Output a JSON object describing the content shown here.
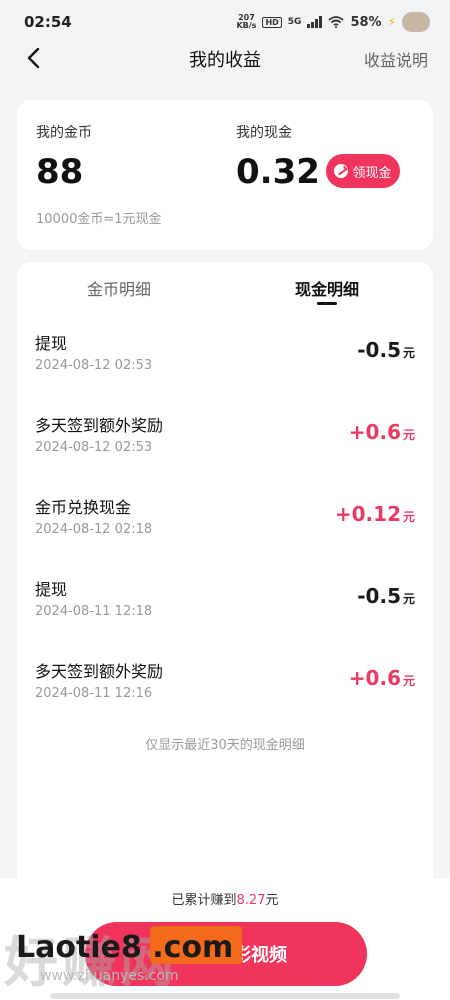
{
  "status_bar": {
    "time": "02:54",
    "speed_top": "207",
    "speed_bottom": "KB/s",
    "hd": "HD",
    "network": "5G",
    "battery": "58%"
  },
  "nav": {
    "title": "我的收益",
    "explain": "收益说明"
  },
  "summary": {
    "coin_label": "我的金币",
    "coin_value": "88",
    "cash_label": "我的现金",
    "cash_value": "0.32",
    "claim_label": "领现金",
    "rate_text": "10000金币=1元现金"
  },
  "tabs": {
    "coin": "金币明细",
    "cash": "现金明细"
  },
  "records": [
    {
      "title": "提现",
      "date": "2024-08-12 02:53",
      "amount": "-0.5",
      "unit": "元"
    },
    {
      "title": "多天签到额外奖励",
      "date": "2024-08-12 02:53",
      "amount": "+0.6",
      "unit": "元"
    },
    {
      "title": "金币兑换现金",
      "date": "2024-08-12 02:18",
      "amount": "+0.12",
      "unit": "元"
    },
    {
      "title": "提现",
      "date": "2024-08-11 12:18",
      "amount": "-0.5",
      "unit": "元"
    },
    {
      "title": "多天签到额外奖励",
      "date": "2024-08-11 12:16",
      "amount": "+0.6",
      "unit": "元"
    }
  ],
  "notice": "仅显示最近30天的现金明细",
  "bottom": {
    "total_prefix": "已累计赚到",
    "total_amount": "8.27",
    "total_unit": "元",
    "button_label": "精彩视频"
  },
  "watermark": {
    "bg_text": "好赚网",
    "main_text": "Laotie8 .com",
    "sub_text": "www.zhuanyes.com"
  },
  "colors": {
    "accent": "#f0345c",
    "positive": "#ea3a64",
    "negative": "#1a1a1a"
  }
}
